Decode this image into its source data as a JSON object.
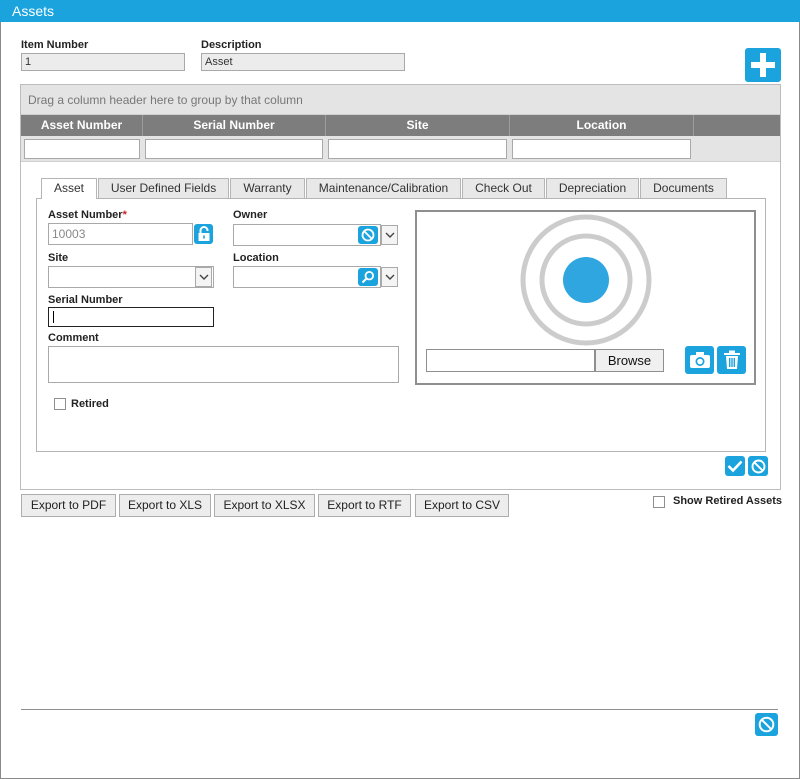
{
  "window": {
    "title": "Assets"
  },
  "header": {
    "item_number_label": "Item Number",
    "item_number_value": "1",
    "description_label": "Description",
    "description_value": "Asset"
  },
  "grid": {
    "group_hint": "Drag a column header here to group by that column",
    "columns": [
      "Asset Number",
      "Serial Number",
      "Site",
      "Location"
    ]
  },
  "tabs": [
    "Asset",
    "User Defined Fields",
    "Warranty",
    "Maintenance/Calibration",
    "Check Out",
    "Depreciation",
    "Documents"
  ],
  "form": {
    "asset_number_label": "Asset Number",
    "required_mark": "*",
    "asset_number_value": "10003",
    "owner_label": "Owner",
    "site_label": "Site",
    "location_label": "Location",
    "serial_number_label": "Serial Number",
    "comment_label": "Comment",
    "retired_label": "Retired"
  },
  "image_panel": {
    "browse_label": "Browse"
  },
  "export_buttons": [
    "Export to PDF",
    "Export to XLS",
    "Export to XLSX",
    "Export to RTF",
    "Export to CSV"
  ],
  "show_retired_label": "Show Retired Assets",
  "colors": {
    "accent": "#1aa3dd",
    "header_gray": "#7d7d7d",
    "target_gray": "#cccccc",
    "target_blue": "#2fa6df"
  },
  "icons": [
    "add-icon",
    "lock-icon",
    "cancel-icon",
    "search-icon",
    "chevron-down-icon",
    "camera-icon",
    "trash-icon",
    "check-icon"
  ]
}
